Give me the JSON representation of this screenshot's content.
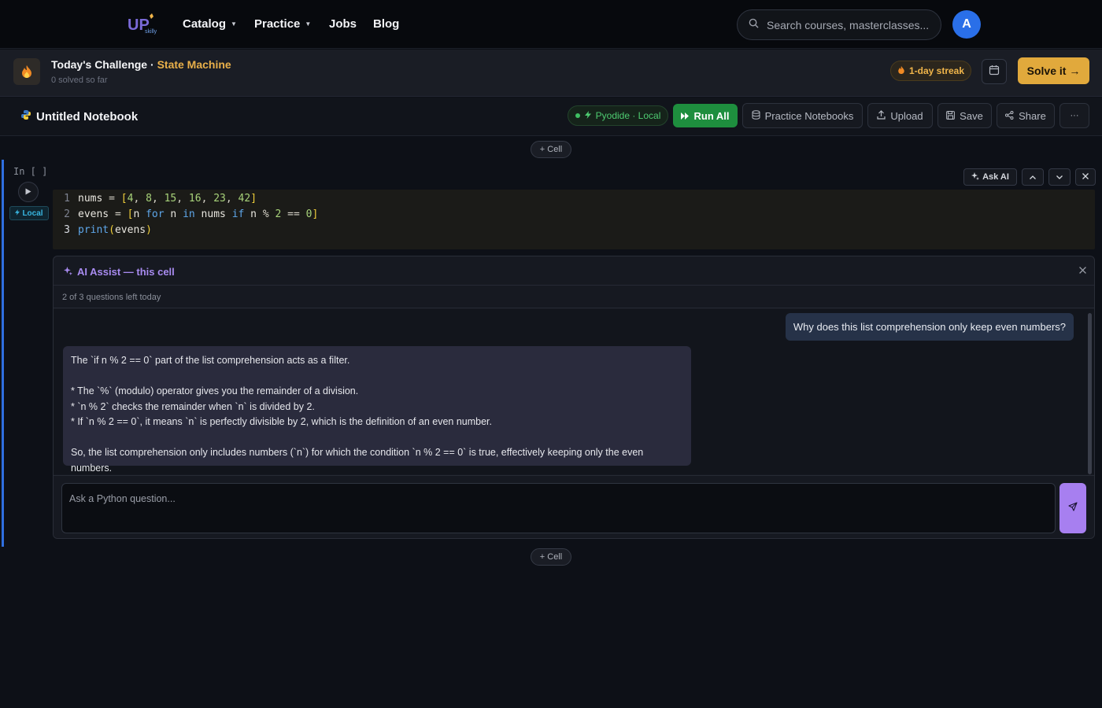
{
  "nav": {
    "logo_text": "UPskilly",
    "links": [
      {
        "label": "Catalog",
        "has_caret": true
      },
      {
        "label": "Practice",
        "has_caret": true
      },
      {
        "label": "Jobs",
        "has_caret": false
      },
      {
        "label": "Blog",
        "has_caret": false
      }
    ],
    "search_placeholder": "Search courses, masterclasses...",
    "avatar_initial": "A"
  },
  "challenge": {
    "label": "Today's Challenge",
    "separator": " · ",
    "name": "State Machine",
    "subtitle": "0 solved so far",
    "streak": "1-day streak",
    "solve_label": "Solve it →"
  },
  "notebook": {
    "title": "Untitled Notebook",
    "runtime": "Pyodide · Local",
    "run_all": "Run All",
    "practice": "Practice Notebooks",
    "upload": "Upload",
    "save": "Save",
    "share": "Share",
    "more": "···",
    "add_cell": "+ Cell"
  },
  "cell": {
    "prompt": "In [ ]",
    "tag": "Local",
    "ask_ai": "Ask AI",
    "line_numbers": [
      "1",
      "2",
      "3"
    ],
    "code": [
      "nums = [4, 8, 15, 16, 23, 42]",
      "evens = [n for n in nums if n % 2 == 0]",
      "print(evens)"
    ]
  },
  "ai": {
    "title": "AI Assist — this cell",
    "quota": "2 of 3 questions left today",
    "user_message": "Why does this list comprehension only keep even numbers?",
    "assistant_lines": [
      "The `if n % 2 == 0` part of the list comprehension acts as a filter.",
      "",
      "* The `%` (modulo) operator gives you the remainder of a division.",
      "* `n % 2` checks the remainder when `n` is divided by 2.",
      "* If `n % 2 == 0`, it means `n` is perfectly divisible by 2, which is the definition of an even number.",
      "",
      "So, the list comprehension only includes numbers (`n`) for which the condition `n % 2 == 0` is true, effectively keeping only the even numbers."
    ],
    "input_placeholder": "Ask a Python question..."
  },
  "colors": {
    "accent_blue": "#2f6fe0",
    "gold": "#e1a93c",
    "green": "#1e8e3e",
    "purple": "#a77ff0"
  }
}
